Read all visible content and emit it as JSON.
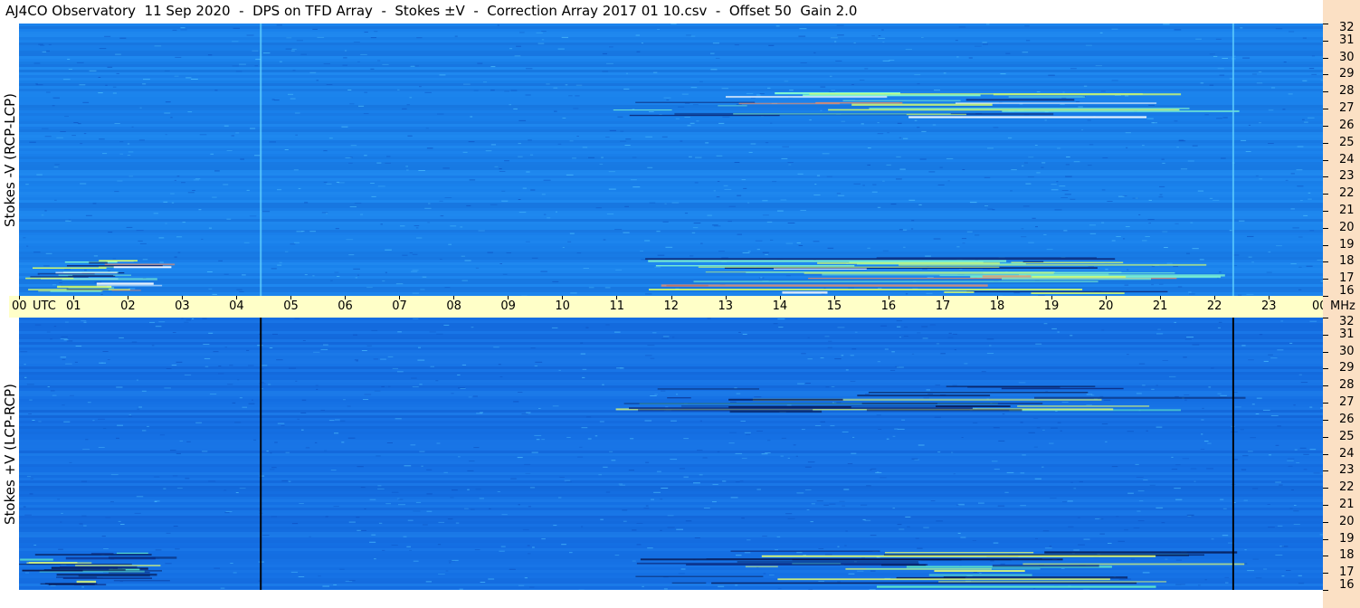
{
  "title": "AJ4CO Observatory  11 Sep 2020  -  DPS on TFD Array  -  Stokes ±V  -  Correction Array 2017 01 10.csv  -  Offset 50  Gain 2.0",
  "panels": {
    "top": {
      "ylabel": "Stokes -V (RCP-LCP)",
      "base_color": "#1a82ec"
    },
    "bottom": {
      "ylabel": "Stokes +V (LCP-RCP)",
      "base_color": "#1570e4"
    }
  },
  "time_axis": {
    "unit_label": "UTC",
    "labels": [
      "00",
      "01",
      "02",
      "03",
      "04",
      "05",
      "06",
      "07",
      "08",
      "09",
      "10",
      "11",
      "12",
      "13",
      "14",
      "15",
      "16",
      "17",
      "18",
      "19",
      "20",
      "21",
      "22",
      "23",
      "00"
    ]
  },
  "freq_axis": {
    "unit_label": "MHz",
    "labels": [
      "32",
      "31",
      "30",
      "29",
      "28",
      "27",
      "26",
      "25",
      "24",
      "23",
      "22",
      "21",
      "20",
      "19",
      "18",
      "17",
      "16"
    ]
  },
  "chart_data": {
    "type": "heatmap",
    "title": "AJ4CO Observatory  11 Sep 2020  -  DPS on TFD Array  -  Stokes ±V  -  Correction Array 2017 01 10.csv  -  Offset 50  Gain 2.0",
    "x_range_utc_hours": [
      0,
      24
    ],
    "y_range_mhz": [
      16,
      32
    ],
    "panels": [
      {
        "name": "Stokes -V (RCP-LCP)",
        "vertical_line_utc": [
          4.45,
          22.35
        ]
      },
      {
        "name": "Stokes +V (LCP-RCP)",
        "vertical_line_utc": [
          4.45,
          22.35
        ]
      }
    ],
    "activity_bands": [
      {
        "utc_start": 0.0,
        "utc_end": 3.0,
        "mhz_low": 16.2,
        "mhz_high": 18.2
      },
      {
        "utc_start": 11.3,
        "utc_end": 24.0,
        "mhz_low": 16.2,
        "mhz_high": 18.4
      },
      {
        "utc_start": 10.8,
        "utc_end": 24.0,
        "mhz_low": 26.5,
        "mhz_high": 28.0
      }
    ]
  }
}
